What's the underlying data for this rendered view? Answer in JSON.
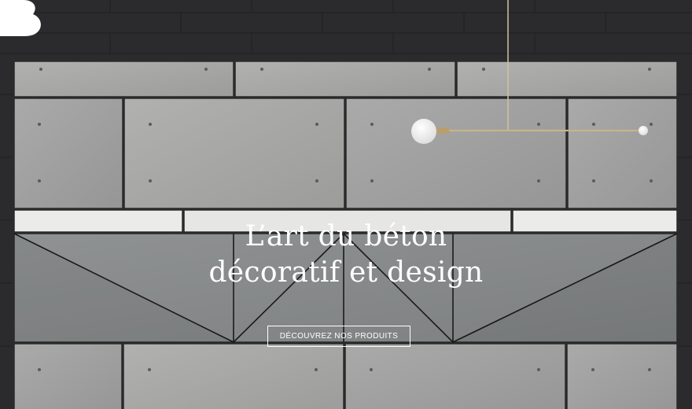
{
  "brand": {
    "logo_icon": "b-letter-logo-icon"
  },
  "hero": {
    "headline_line1": "L’art du béton",
    "headline_line2": "décoratif et design",
    "cta_label": "DÉCOUVREZ NOS PRODUITS",
    "background": "concrete-panel-wall-with-pendant-lamp"
  },
  "colors": {
    "wall": "#2b2b2d",
    "concrete": "#a4a4a3",
    "concrete_dark": "#8e9192",
    "white_strip": "#e9e9e8",
    "text": "#ffffff",
    "brass": "#c8b48a"
  }
}
